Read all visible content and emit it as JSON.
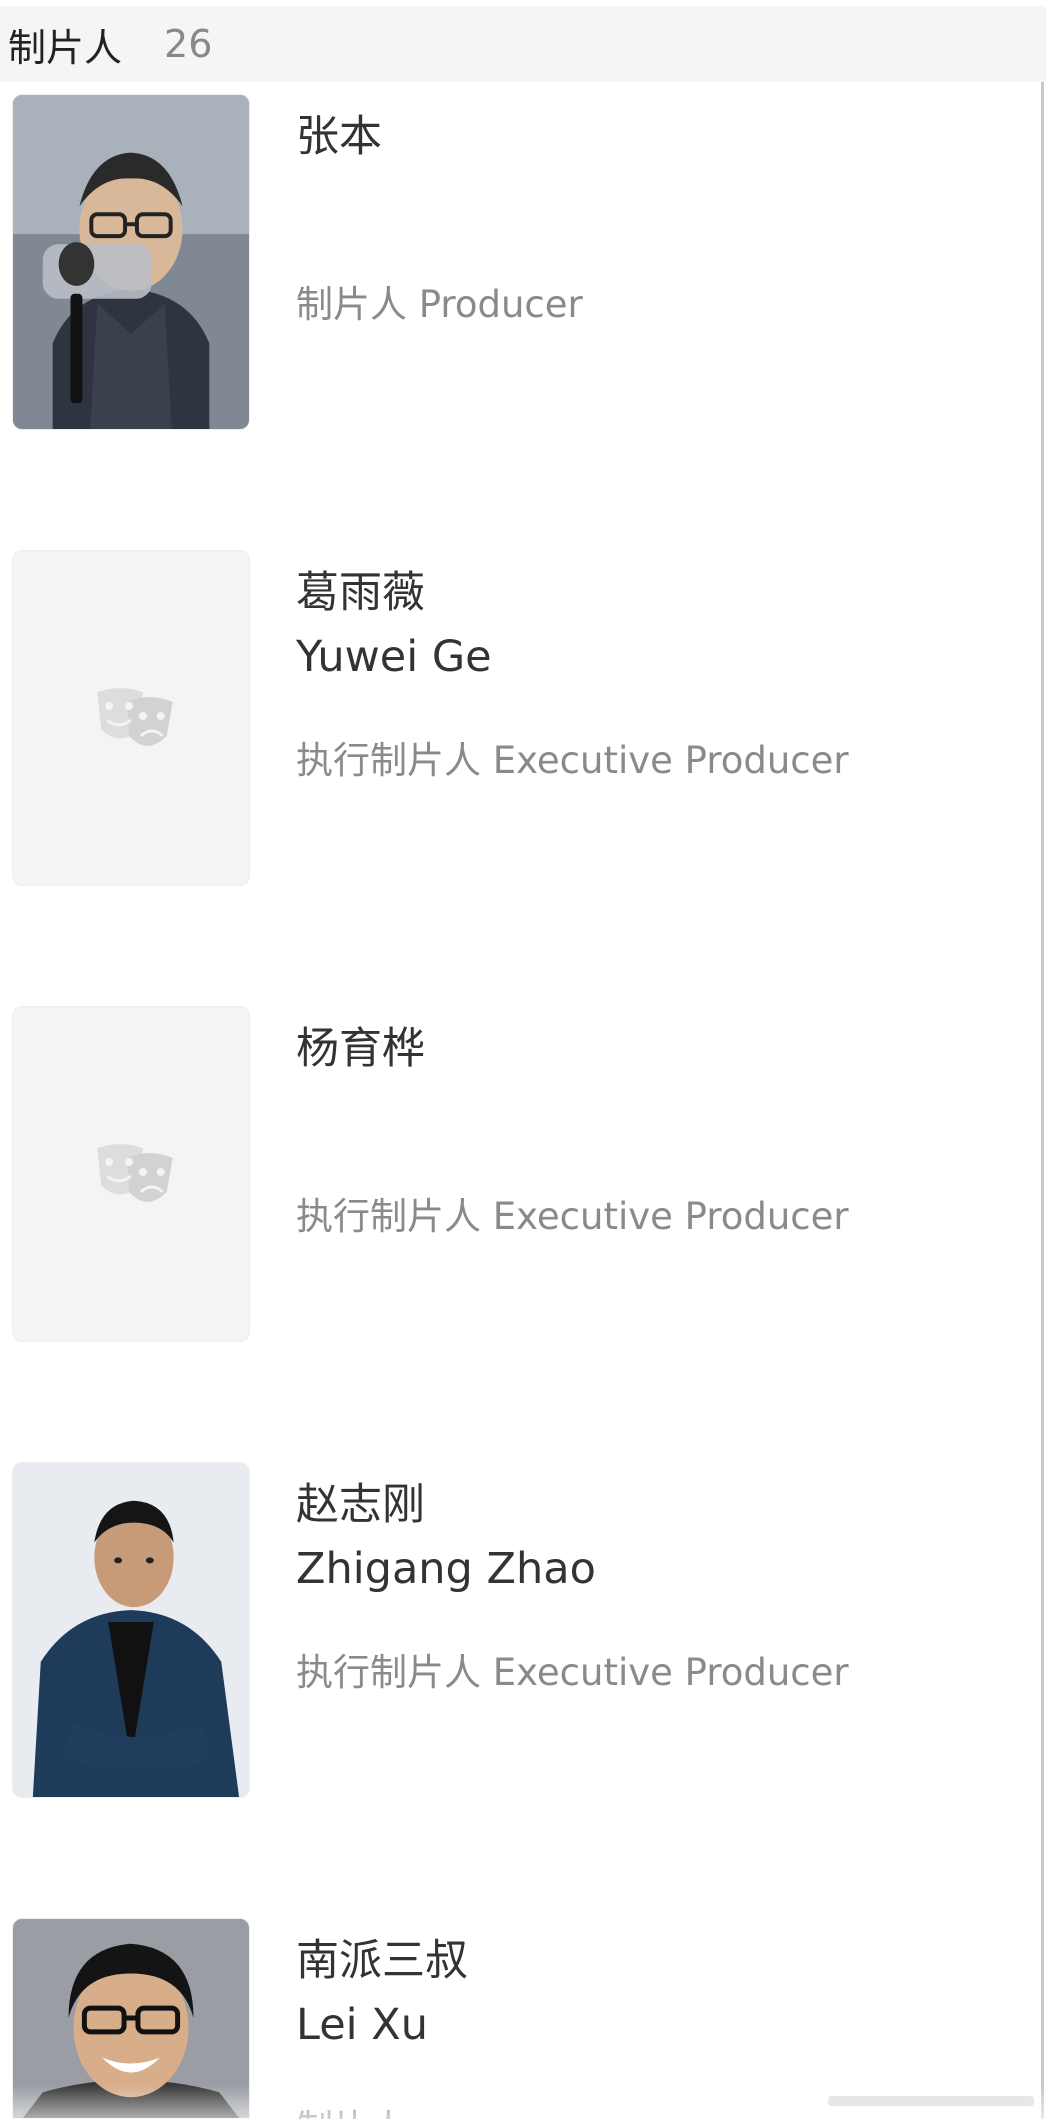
{
  "section": {
    "title": "制片人",
    "count": "26"
  },
  "people": [
    {
      "name_cn": "张本",
      "name_en": "",
      "role": "制片人 Producer",
      "photo": "headshot-photo"
    },
    {
      "name_cn": "葛雨薇",
      "name_en": "Yuwei Ge",
      "role": "执行制片人 Executive Producer",
      "photo": "placeholder-masks-icon"
    },
    {
      "name_cn": "杨育桦",
      "name_en": "",
      "role": "执行制片人 Executive Producer",
      "photo": "placeholder-masks-icon"
    },
    {
      "name_cn": "赵志刚",
      "name_en": "Zhigang Zhao",
      "role": "执行制片人 Executive Producer",
      "photo": "portrait-photo"
    },
    {
      "name_cn": "南派三叔",
      "name_en": "Lei Xu",
      "role": "制片人",
      "photo": "portrait-photo"
    }
  ],
  "colors": {
    "header_bg": "#f5f5f5",
    "name_text": "#333333",
    "role_text": "#8a8a8a",
    "placeholder_bg": "#f4f4f4"
  }
}
